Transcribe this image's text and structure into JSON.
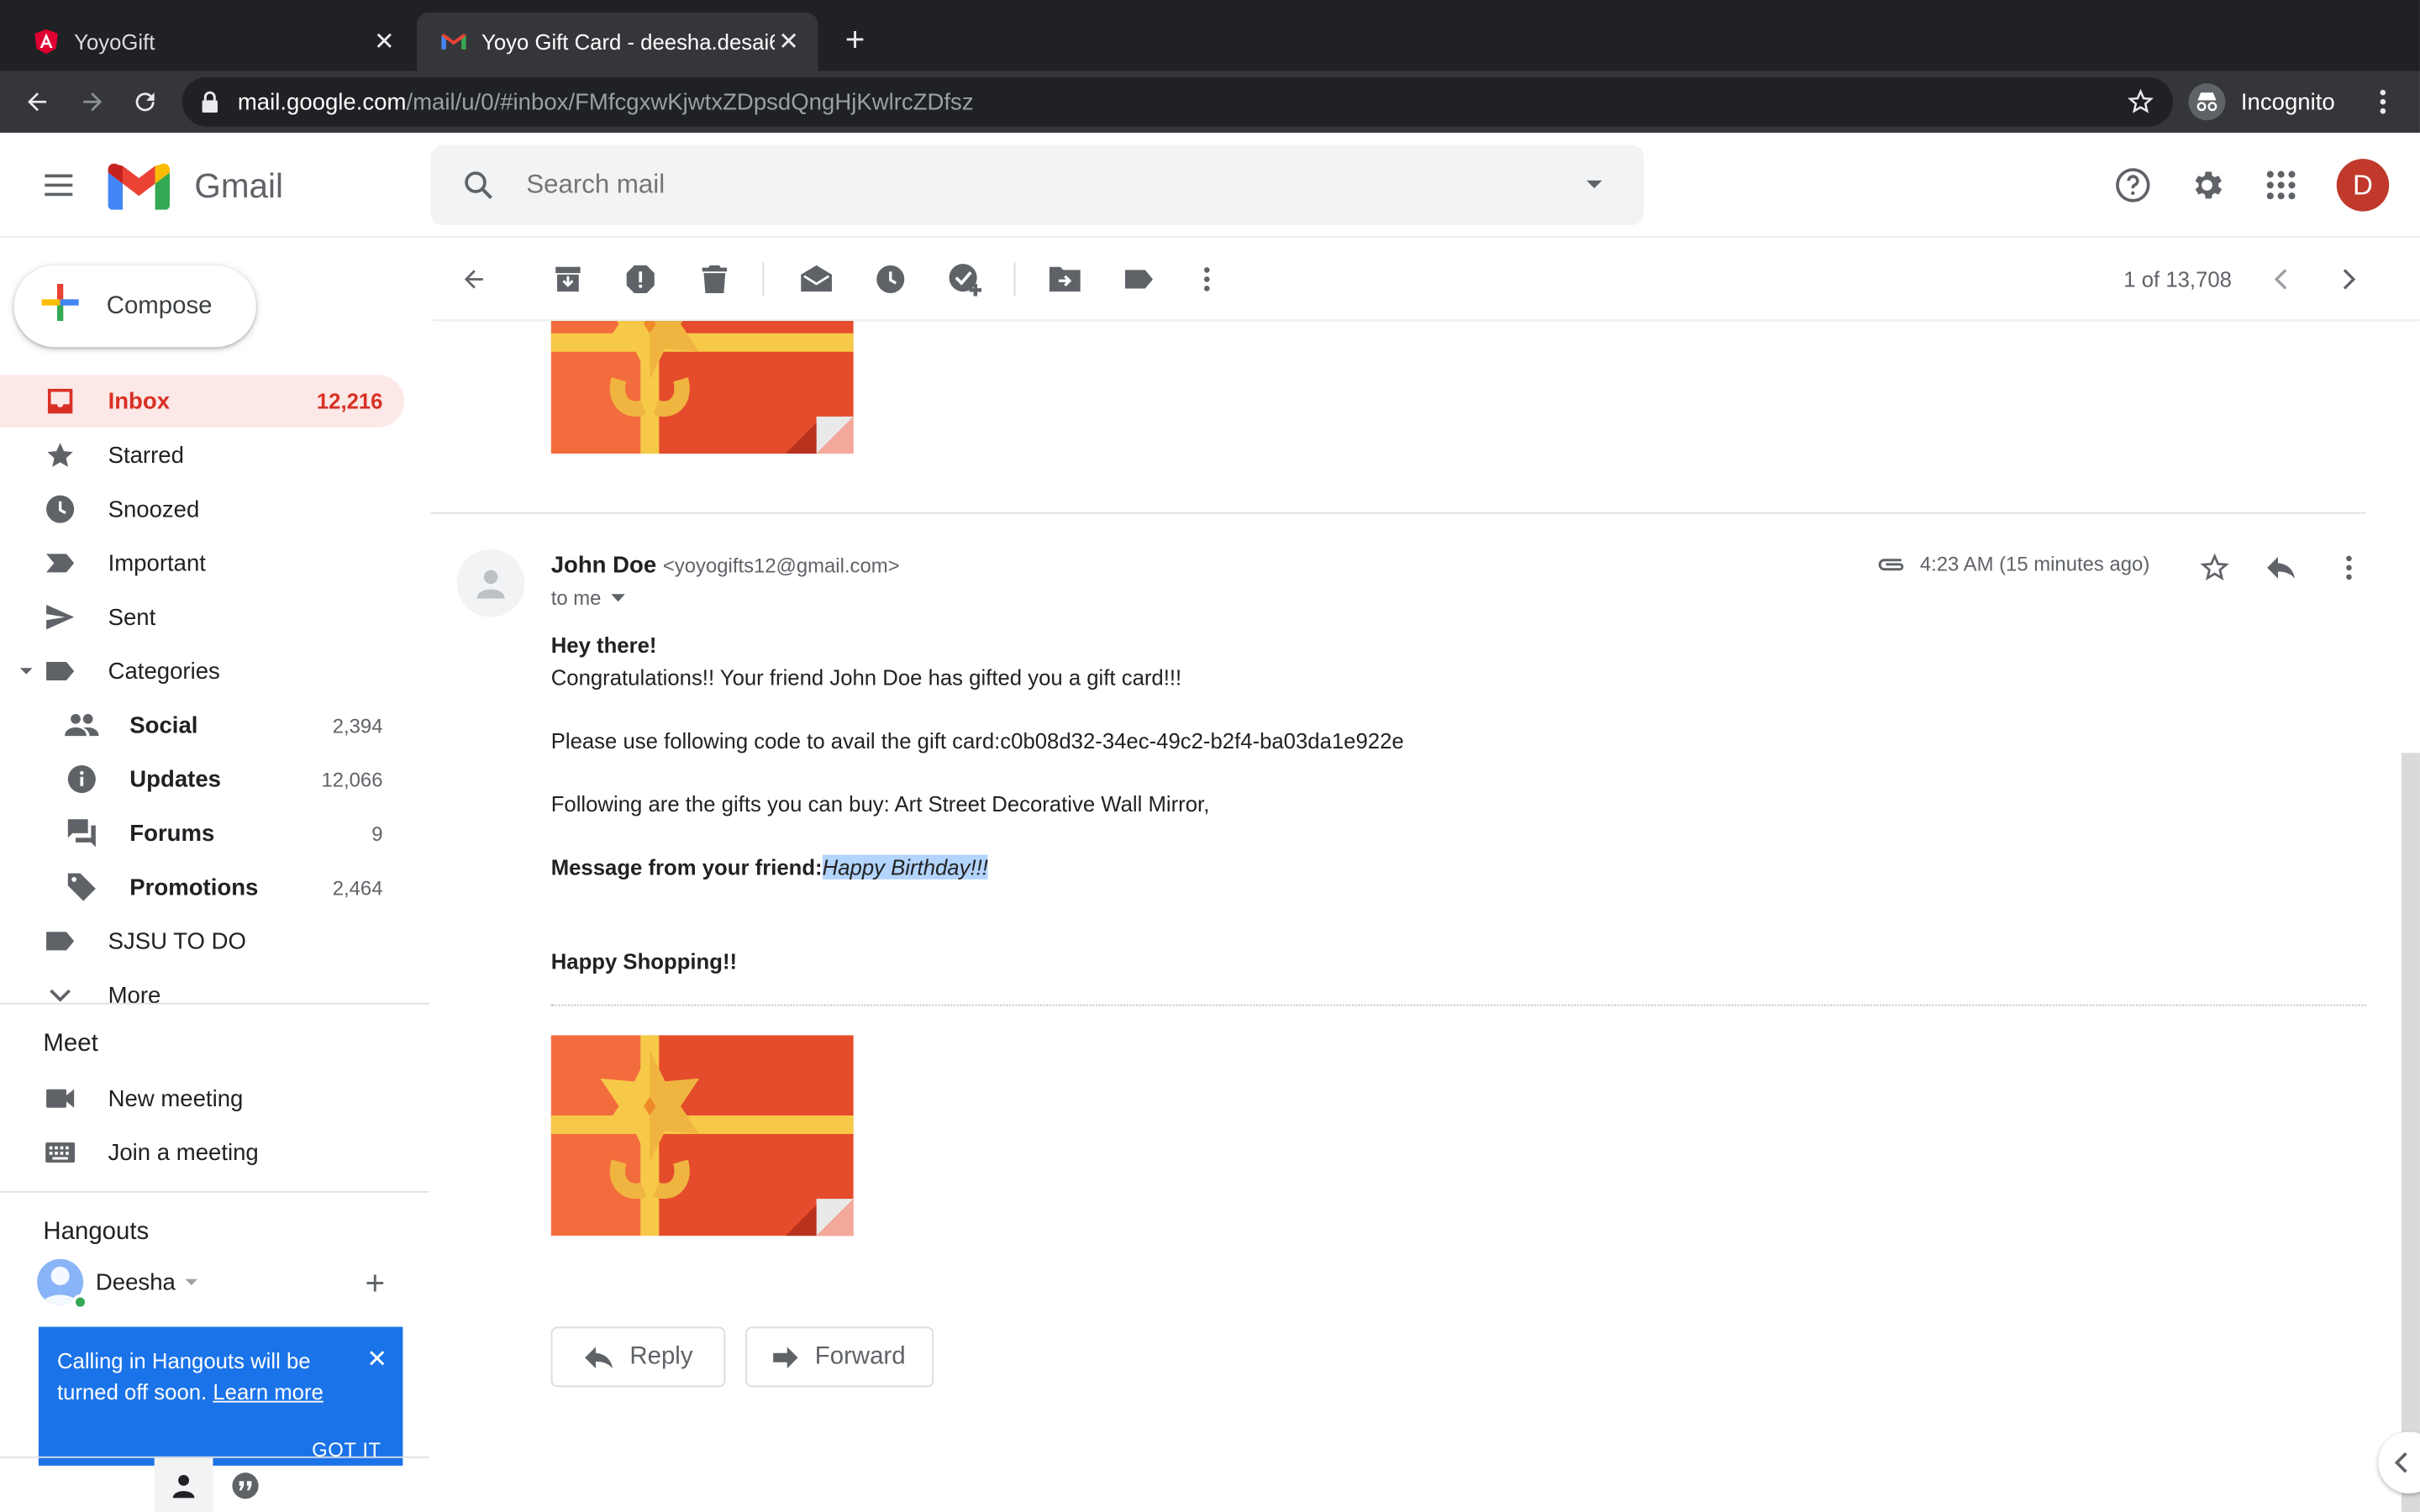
{
  "browser": {
    "tabs": [
      {
        "title": "YoyoGift",
        "active": false
      },
      {
        "title": "Yoyo Gift Card - deesha.desai6",
        "active": true
      }
    ],
    "url_host": "mail.google.com",
    "url_path": "/mail/u/0/#inbox/FMfcgxwKjwtxZDpsdQngHjKwlrcZDfsz",
    "incognito_label": "Incognito"
  },
  "gmail": {
    "app_name": "Gmail",
    "search_placeholder": "Search mail",
    "avatar_initial": "D"
  },
  "sidebar": {
    "compose_label": "Compose",
    "items": [
      {
        "label": "Inbox",
        "count": "12,216",
        "icon": "inbox-icon"
      },
      {
        "label": "Starred",
        "count": "",
        "icon": "star-icon"
      },
      {
        "label": "Snoozed",
        "count": "",
        "icon": "clock-icon"
      },
      {
        "label": "Important",
        "count": "",
        "icon": "important-icon"
      },
      {
        "label": "Sent",
        "count": "",
        "icon": "send-icon"
      },
      {
        "label": "Categories",
        "count": "",
        "icon": "label-icon"
      },
      {
        "label": "Social",
        "count": "2,394",
        "icon": "people-icon"
      },
      {
        "label": "Updates",
        "count": "12,066",
        "icon": "info-icon"
      },
      {
        "label": "Forums",
        "count": "9",
        "icon": "forum-icon"
      },
      {
        "label": "Promotions",
        "count": "2,464",
        "icon": "tag-icon"
      },
      {
        "label": "SJSU TO DO",
        "count": "",
        "icon": "label-icon"
      },
      {
        "label": "More",
        "count": "",
        "icon": "chevron-down-icon"
      }
    ],
    "meet": {
      "title": "Meet",
      "new_meeting": "New meeting",
      "join_meeting": "Join a meeting"
    },
    "hangouts": {
      "title": "Hangouts",
      "user": "Deesha",
      "notice_text": "Calling in Hangouts will be turned off soon.",
      "notice_link": "Learn more",
      "notice_button": "GOT IT"
    }
  },
  "toolbar": {
    "pager": "1 of 13,708"
  },
  "message": {
    "sender_name": "John Doe",
    "sender_email": "<yoyogifts12@gmail.com>",
    "to": "to me",
    "time": "4:23 AM (15 minutes ago)",
    "greeting": "Hey there!",
    "line1": "Congratulations!! Your friend John Doe has gifted you a gift card!!!",
    "line2": "Please use following code to avail the gift card:c0b08d32-34ec-49c2-b2f4-ba03da1e922e",
    "line3": "Following are the gifts you can buy: Art Street Decorative Wall Mirror,",
    "friend_msg_label": "Message from your friend:",
    "friend_msg": "Happy Birthday!!!",
    "closing": "Happy Shopping!!",
    "reply_label": "Reply",
    "forward_label": "Forward"
  },
  "colors": {
    "gift_orange": "#f36c3d",
    "gift_red": "#e44c2c",
    "gift_yellow": "#f7c948",
    "active_red": "#d93025",
    "notice_blue": "#1a73e8"
  }
}
